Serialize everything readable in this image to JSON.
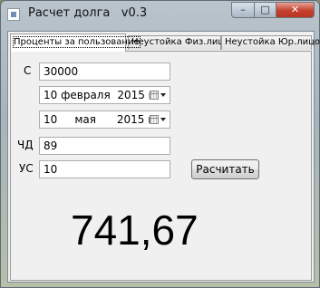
{
  "window": {
    "title": "Расчет долга   v0.3",
    "minimize_glyph": "–",
    "maximize_glyph": "□",
    "close_glyph": "✕"
  },
  "tabs": [
    {
      "label": "Проценты за пользование",
      "active": true
    },
    {
      "label": "Неустойка Физ.лицо",
      "active": false
    },
    {
      "label": "Неустойка Юр.лицо",
      "active": false
    }
  ],
  "form": {
    "c_label": "С",
    "c_value": "30000",
    "date1": {
      "day": "10",
      "month": "февраля",
      "year": "2015 г."
    },
    "date2": {
      "day": "10",
      "month": "мая",
      "year": "2015 г."
    },
    "chd_label": "ЧД",
    "chd_value": "89",
    "us_label": "УС",
    "us_value": "10",
    "calc_button": "Расчитать"
  },
  "result": "741,67"
}
